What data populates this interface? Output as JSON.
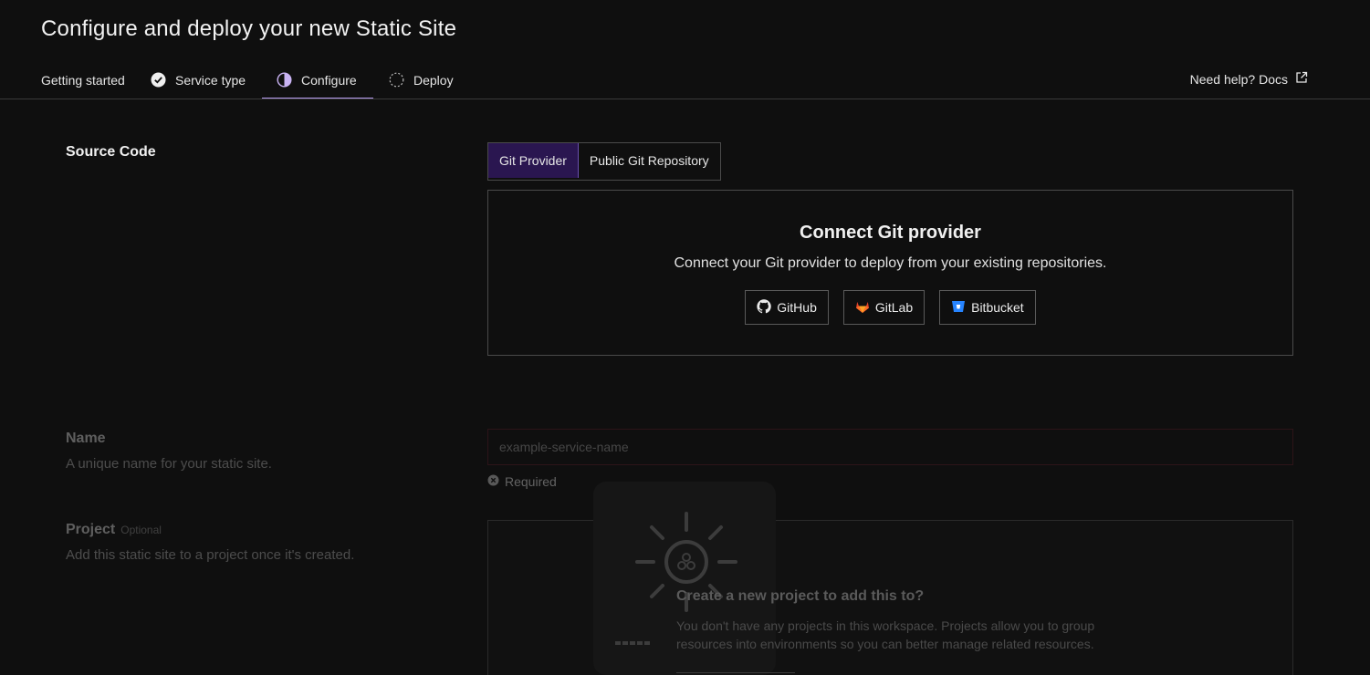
{
  "title": "Configure and deploy your new Static Site",
  "steps": [
    {
      "label": "Getting started",
      "state": "done-plain"
    },
    {
      "label": "Service type",
      "state": "complete",
      "icon": "check-circle-icon"
    },
    {
      "label": "Configure",
      "state": "current",
      "icon": "half-circle-icon"
    },
    {
      "label": "Deploy",
      "state": "pending",
      "icon": "dashed-circle-icon"
    }
  ],
  "help": {
    "label": "Need help? Docs",
    "icon": "external-link-icon"
  },
  "source_code": {
    "label": "Source Code",
    "tabs": [
      {
        "label": "Git Provider",
        "selected": true
      },
      {
        "label": "Public Git Repository",
        "selected": false
      }
    ],
    "connect": {
      "title": "Connect Git provider",
      "subtitle": "Connect your Git provider to deploy from your existing repositories.",
      "providers": [
        {
          "label": "GitHub",
          "icon": "github-icon"
        },
        {
          "label": "GitLab",
          "icon": "gitlab-icon"
        },
        {
          "label": "Bitbucket",
          "icon": "bitbucket-icon"
        }
      ]
    }
  },
  "name": {
    "label": "Name",
    "description": "A unique name for your static site.",
    "placeholder": "example-service-name",
    "value": "",
    "error": "Required"
  },
  "project": {
    "label": "Project",
    "optional": "Optional",
    "description": "Add this static site to a project once it's created.",
    "empty_title": "Create a new project to add this to?",
    "empty_desc": "You don't have any projects in this workspace. Projects allow you to group resources into environments so you can better manage related resources."
  },
  "colors": {
    "accent": "#b79cf0",
    "selected_bg": "#2a1650",
    "error_border": "#5a1c26"
  }
}
